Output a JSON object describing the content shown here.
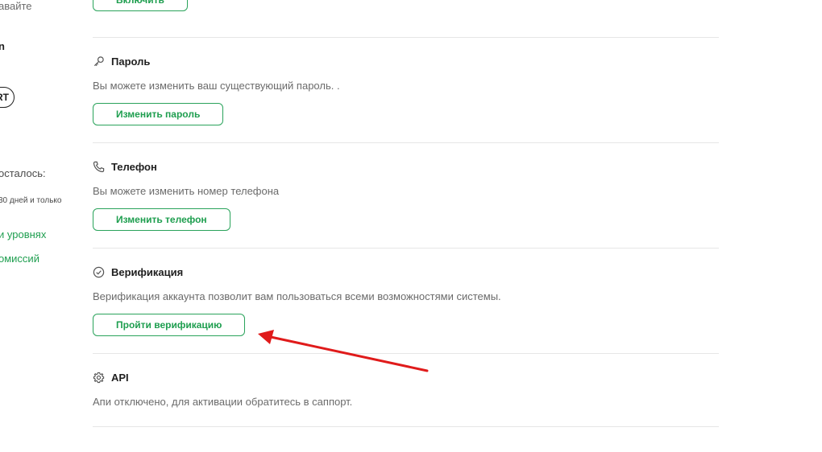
{
  "sidebar": {
    "save_fragment": "авайте",
    "name_fragment": "n",
    "badge_fragment": "RT",
    "remaining_fragment": "осталось:",
    "days_fragment": "30 дней и только",
    "link_levels": "и уровнях",
    "link_fees": "омиссий"
  },
  "top": {
    "enable_button": "Включить"
  },
  "sections": {
    "password": {
      "title": "Пароль",
      "description": "Вы можете изменить ваш существующий пароль. .",
      "button": "Изменить пароль"
    },
    "phone": {
      "title": "Телефон",
      "description": "Вы можете изменить номер телефона",
      "button": "Изменить телефон"
    },
    "verification": {
      "title": "Верификация",
      "description": "Верификация аккаунта позволит вам пользоваться всеми возможностями системы.",
      "button": "Пройти верификацию"
    },
    "api": {
      "title": "API",
      "description": "Апи отключено, для активации обратитесь в саппорт."
    }
  },
  "colors": {
    "accent_green": "#1e9e4f",
    "annotation_red": "#e01b1b",
    "divider": "#e6e6e6"
  },
  "icons": {
    "password": "key-icon",
    "phone": "phone-icon",
    "verification": "check-circle-icon",
    "api": "gear-icon"
  }
}
